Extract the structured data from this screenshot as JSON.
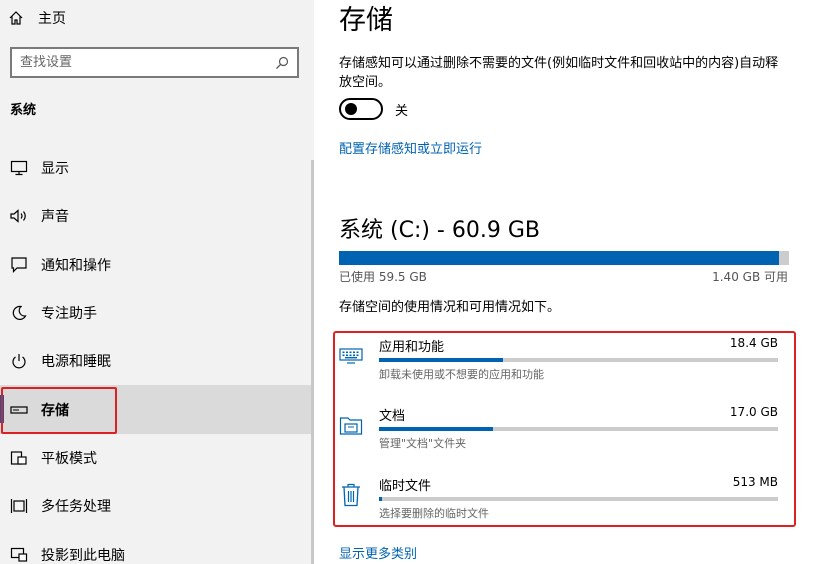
{
  "sidebar": {
    "home_label": "主页",
    "search_placeholder": "查找设置",
    "section_label": "系统",
    "items": [
      {
        "label": "显示",
        "icon": "display-icon"
      },
      {
        "label": "声音",
        "icon": "speaker-icon"
      },
      {
        "label": "通知和操作",
        "icon": "notification-icon"
      },
      {
        "label": "专注助手",
        "icon": "moon-icon"
      },
      {
        "label": "电源和睡眠",
        "icon": "power-icon"
      },
      {
        "label": "存储",
        "icon": "storage-drive-icon",
        "active": true
      },
      {
        "label": "平板模式",
        "icon": "tablet-mode-icon"
      },
      {
        "label": "多任务处理",
        "icon": "multitasking-icon"
      },
      {
        "label": "投影到此电脑",
        "icon": "project-icon"
      }
    ]
  },
  "main": {
    "title": "存储",
    "storage_sense_desc": "存储感知可以通过删除不需要的文件(例如临时文件和回收站中的内容)自动释放空间。",
    "toggle_state_label": "关",
    "toggle_on": false,
    "config_link": "配置存储感知或立即运行",
    "drive": {
      "title": "系统 (C:) - 60.9 GB",
      "used_label": "已使用 59.5 GB",
      "free_label": "1.40 GB 可用",
      "used_fraction": 0.977
    },
    "usage_desc": "存储空间的使用情况和可用情况如下。",
    "categories": [
      {
        "name": "应用和功能",
        "size": "18.4 GB",
        "sub": "卸载未使用或不想要的应用和功能",
        "fraction": 0.31,
        "icon": "keyboard-icon"
      },
      {
        "name": "文档",
        "size": "17.0 GB",
        "sub": "管理\"文档\"文件夹",
        "fraction": 0.285,
        "icon": "folder-icon"
      },
      {
        "name": "临时文件",
        "size": "513 MB",
        "sub": "选择要删除的临时文件",
        "fraction": 0.008,
        "icon": "trash-icon"
      }
    ],
    "more_link": "显示更多类别"
  },
  "colors": {
    "accent": "#0063b1",
    "highlight_box": "#e02020",
    "sidebar_bg": "#f2f2f2",
    "active_bg": "#dadada"
  }
}
